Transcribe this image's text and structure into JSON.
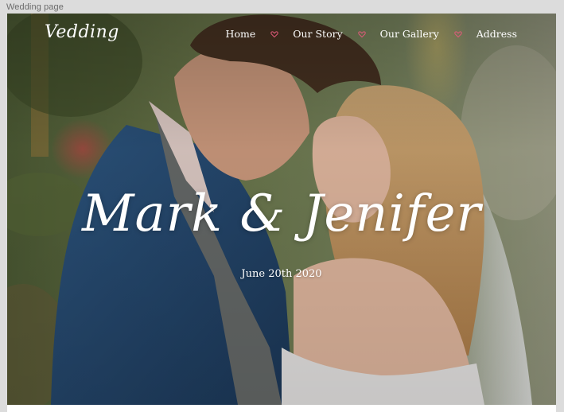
{
  "window": {
    "title": "Wedding page"
  },
  "header": {
    "logo": "Vedding",
    "nav": [
      {
        "label": "Home"
      },
      {
        "label": "Our Story"
      },
      {
        "label": "Our Gallery"
      },
      {
        "label": "Address"
      }
    ],
    "separator_icon": "heart-icon",
    "separator_color": "#e05a7a"
  },
  "hero": {
    "names": "Mark & Jenifer",
    "date": "June 20th 2020",
    "image_subject": "couple-embracing-photo"
  }
}
